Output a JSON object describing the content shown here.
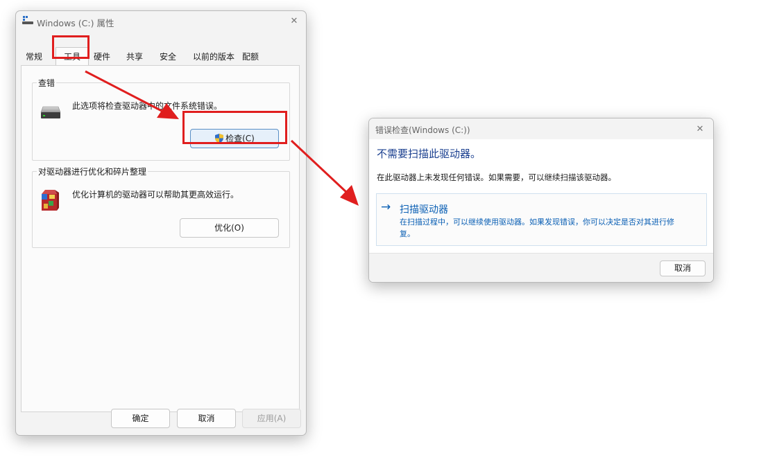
{
  "props_window": {
    "title": "Windows (C:) 属性",
    "tabs": [
      "常规",
      "工具",
      "硬件",
      "共享",
      "安全",
      "以前的版本",
      "配额"
    ],
    "error_check": {
      "group_label": "查错",
      "description": "此选项将检查驱动器中的文件系统错误。",
      "check_button": "检查(C)"
    },
    "optimize": {
      "group_label": "对驱动器进行优化和碎片整理",
      "description": "优化计算机的驱动器可以帮助其更高效运行。",
      "optimize_button": "优化(O)"
    },
    "buttons": {
      "ok": "确定",
      "cancel": "取消",
      "apply": "应用(A)"
    }
  },
  "dialog": {
    "title": "错误检查(Windows (C:))",
    "heading": "不需要扫描此驱动器。",
    "message": "在此驱动器上未发现任何错误。如果需要，可以继续扫描该驱动器。",
    "scan_option": {
      "title": "扫描驱动器",
      "arrow": "→",
      "description_line1": "在扫描过程中，可以继续使用驱动器。如果发现错误，你可以决定是否对其进行修",
      "description_line2": "复。"
    },
    "cancel": "取消"
  },
  "glyphs": {
    "close": "✕"
  },
  "colors": {
    "annotation_red": "#e01e1e",
    "link_blue": "#0a5fb4",
    "heading_blue": "#1a3f8f"
  }
}
